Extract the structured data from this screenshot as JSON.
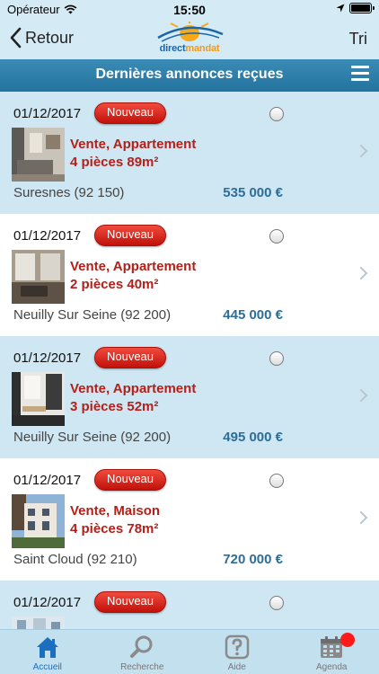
{
  "status_bar": {
    "carrier": "Opérateur",
    "time": "15:50"
  },
  "nav": {
    "back_label": "Retour",
    "sort_label": "Tri",
    "logo_text_a": "direct",
    "logo_text_b": "mandat"
  },
  "header": {
    "title": "Dernières annonces reçues"
  },
  "colors": {
    "accent": "#1a6fc0",
    "badge": "#d8201a",
    "price": "#2c6d99",
    "title": "#b3201a"
  },
  "listings": [
    {
      "date": "01/12/2017",
      "badge": "Nouveau",
      "type": "Vente, Appartement",
      "rooms": "4 pièces 89m²",
      "city": "Suresnes (92 150)",
      "price": "535 000 €"
    },
    {
      "date": "01/12/2017",
      "badge": "Nouveau",
      "type": "Vente, Appartement",
      "rooms": "2 pièces 40m²",
      "city": "Neuilly Sur Seine (92 200)",
      "price": "445 000 €"
    },
    {
      "date": "01/12/2017",
      "badge": "Nouveau",
      "type": "Vente, Appartement",
      "rooms": "3 pièces 52m²",
      "city": "Neuilly Sur Seine (92 200)",
      "price": "495 000 €"
    },
    {
      "date": "01/12/2017",
      "badge": "Nouveau",
      "type": "Vente, Maison",
      "rooms": "4 pièces 78m²",
      "city": "Saint Cloud (92 210)",
      "price": "720 000 €"
    },
    {
      "date": "01/12/2017",
      "badge": "Nouveau",
      "type": "",
      "rooms": "",
      "city": "",
      "price": ""
    }
  ],
  "tabs": [
    {
      "label": "Accueil",
      "icon": "home-icon"
    },
    {
      "label": "Recherche",
      "icon": "search-icon"
    },
    {
      "label": "Aide",
      "icon": "help-icon"
    },
    {
      "label": "Agenda",
      "icon": "calendar-icon"
    }
  ]
}
